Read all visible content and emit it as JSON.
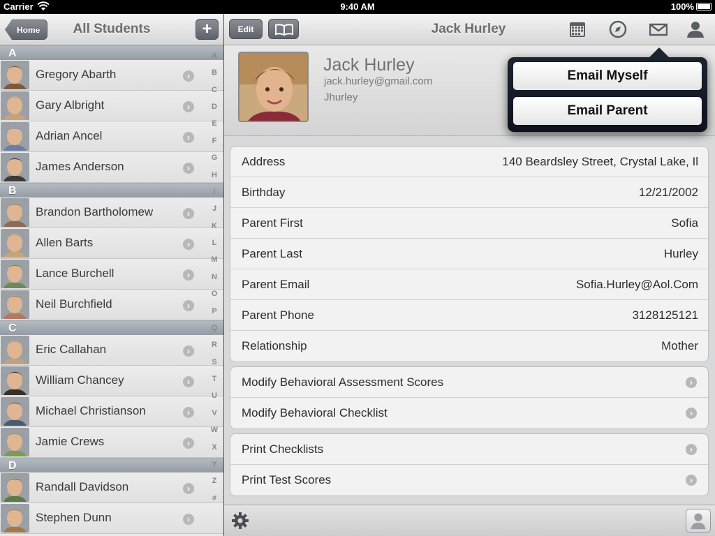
{
  "status": {
    "carrier": "Carrier",
    "time": "9:40 AM",
    "battery": "100%"
  },
  "left": {
    "home_label": "Home",
    "title": "All Students",
    "add_label": "+",
    "sections": [
      {
        "letter": "A",
        "students": [
          "Gregory Abarth",
          "Gary Albright",
          "Adrian Ancel",
          "James Anderson"
        ]
      },
      {
        "letter": "B",
        "students": [
          "Brandon Bartholomew",
          "Allen Barts",
          "Lance Burchell",
          "Neil Burchfield"
        ]
      },
      {
        "letter": "C",
        "students": [
          "Eric Callahan",
          "William Chancey",
          "Michael Christianson",
          "Jamie Crews"
        ]
      },
      {
        "letter": "D",
        "students": [
          "Randall Davidson",
          "Stephen Dunn"
        ]
      }
    ],
    "index": [
      "A",
      "B",
      "C",
      "D",
      "E",
      "F",
      "G",
      "H",
      "I",
      "J",
      "K",
      "L",
      "M",
      "N",
      "O",
      "P",
      "Q",
      "R",
      "S",
      "T",
      "U",
      "V",
      "W",
      "X",
      "Y",
      "Z",
      "#"
    ]
  },
  "right": {
    "edit_label": "Edit",
    "title": "Jack Hurley",
    "profile": {
      "name": "Jack Hurley",
      "email": "jack.hurley@gmail.com",
      "username": "Jhurley"
    },
    "details": [
      {
        "label": "Address",
        "value": "140 Beardsley Street, Crystal Lake, Il"
      },
      {
        "label": "Birthday",
        "value": "12/21/2002"
      },
      {
        "label": "Parent First",
        "value": "Sofia"
      },
      {
        "label": "Parent Last",
        "value": "Hurley"
      },
      {
        "label": "Parent Email",
        "value": "Sofia.Hurley@Aol.Com"
      },
      {
        "label": "Parent Phone",
        "value": "3128125121"
      },
      {
        "label": "Relationship",
        "value": "Mother"
      }
    ],
    "modify_actions": [
      "Modify Behavioral Assessment Scores",
      "Modify Behavioral Checklist"
    ],
    "print_actions": [
      "Print Checklists",
      "Print Test Scores"
    ]
  },
  "popover": {
    "email_myself": "Email Myself",
    "email_parent": "Email Parent"
  },
  "colors": {
    "section_header": "#9aa1a9",
    "nav_button": "#6a6f77",
    "popover_bg": "#141a26"
  },
  "icons": {
    "chevron": "›",
    "avatar_colors": [
      "#7a5a3e",
      "#c9a27a",
      "#6b7fa0",
      "#3c3a38",
      "#8c6b55",
      "#c9a27a",
      "#6d8a5a",
      "#b07a60",
      "#c4a07d",
      "#3b3028",
      "#4a5a70",
      "#7a9a58",
      "#5a7a48",
      "#a07850"
    ]
  }
}
